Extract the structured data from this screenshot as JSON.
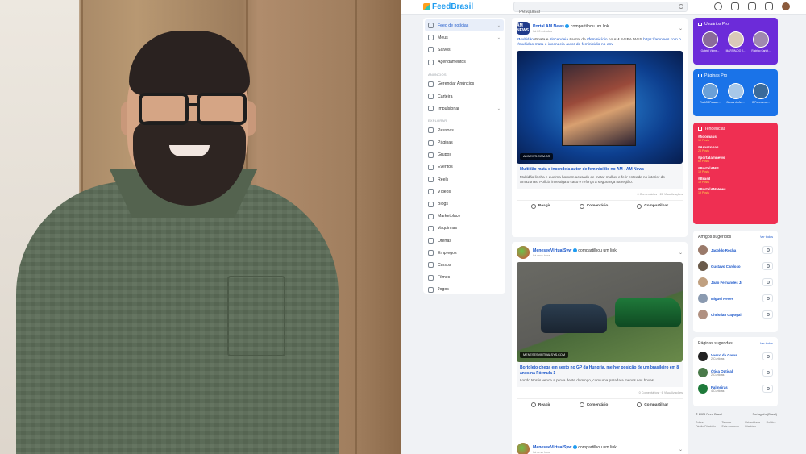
{
  "app": {
    "brand": "FeedBrasil",
    "search_placeholder": "Pesquisar"
  },
  "nav": {
    "main": [
      {
        "label": "Feed de notícias",
        "active": true,
        "has_chevron": true
      },
      {
        "label": "Meus",
        "has_chevron": true
      },
      {
        "label": "Salvos"
      },
      {
        "label": "Agendamentos"
      }
    ],
    "ads_section": "ANÚNCIOS",
    "ads": [
      {
        "label": "Gerenciar Anúncios"
      },
      {
        "label": "Carteira"
      },
      {
        "label": "Impulsionar",
        "has_chevron": true
      }
    ],
    "explore_section": "EXPLORAR",
    "explore": [
      {
        "label": "Pessoas"
      },
      {
        "label": "Páginas"
      },
      {
        "label": "Grupos"
      },
      {
        "label": "Eventos"
      },
      {
        "label": "Reels"
      },
      {
        "label": "Vídeos"
      },
      {
        "label": "Blogs"
      },
      {
        "label": "Marketplace"
      },
      {
        "label": "Vaquinhas"
      },
      {
        "label": "Ofertas"
      },
      {
        "label": "Empregos"
      },
      {
        "label": "Cursos"
      },
      {
        "label": "Filmes"
      },
      {
        "label": "Jogos"
      }
    ]
  },
  "posts": [
    {
      "avatar_text": "AM NEWS",
      "author": "Portal AM News",
      "action": "compartilhou um link",
      "time": "há 20 minutos",
      "text_parts": [
        {
          "t": "#Multidão",
          "tag": true
        },
        {
          "t": " #mata e "
        },
        {
          "t": "#incendeia",
          "tag": true
        },
        {
          "t": " #autor de "
        },
        {
          "t": "#feminicídio",
          "tag": true
        },
        {
          "t": " no AM SAIBA MAIS "
        },
        {
          "t": "https://amnews.com.br/multidao-mata-e-incendeia-autor-de-feminicidio-no-am/",
          "tag": true
        }
      ],
      "image_tag": "AMNEWS.COM.BR",
      "link_title": "Multidão mata e incendeia autor de feminicídio no AM - AM News",
      "link_desc": "Multidão lincha e queima homem acusado de matar mulher e ferir enteada no interior do Amazonas. Polícia investiga o caso e reforça a segurança na região.",
      "stats": "0 Comentários · 28 Visualizações",
      "actions": [
        "Reagir",
        "Comentário",
        "Compartilhar"
      ]
    },
    {
      "author": "MeneseeVirtualSyw",
      "action": "compartilhou um link",
      "time": "há uma hora",
      "image_tag": "MENESESVIRTUALSYS.COM",
      "link_title": "Bortoleto chega em sexto no GP da Hungria, melhor posição de um brasileiro em 8 anos na Fórmula 1",
      "link_desc": "Londo Norris vence a prova deste domingo, com uma parada a menos nos boxes",
      "stats": "0 Comentários · 6 Visualizações",
      "actions": [
        "Reagir",
        "Comentário",
        "Compartilhar"
      ]
    },
    {
      "author": "MeneseeVirtualSyw",
      "action": "compartilhou um link",
      "time": "há uma hora"
    }
  ],
  "sidebar": {
    "pro_users": {
      "title": "Usuários Pro",
      "users": [
        "Gabriel Vidme...",
        "MARIVALDO J...",
        "Rodrigo Carlot..."
      ]
    },
    "pro_pages": {
      "title": "Páginas Pro",
      "pages": [
        "RockSGPassan...",
        "Canais da Am...",
        "O Povo Amaz..."
      ]
    },
    "trends": {
      "title": "Tendências",
      "items": [
        {
          "tag": "#fidomaus",
          "count": "19 Posts"
        },
        {
          "tag": "#Amazonas",
          "count": "24 Posts"
        },
        {
          "tag": "#portalamnews",
          "count": "60 Posts"
        },
        {
          "tag": "#PortalAMS",
          "count": "19 Posts"
        },
        {
          "tag": "#Brasil",
          "count": "19 Posts"
        },
        {
          "tag": "#PortalAMNews",
          "count": "19 Posts"
        }
      ]
    },
    "friends": {
      "title": "Amigos sugeridos",
      "see_all": "Ver todos",
      "items": [
        "Jacoldo Rocha",
        "Gustavo Cardoso",
        "Joao Fernandes Jr",
        "Miguel Neves",
        "Christian Capogal"
      ]
    },
    "pages": {
      "title": "Páginas sugeridas",
      "see_all": "Ver todos",
      "items": [
        {
          "name": "Vasco da Gama",
          "sub": "2 Curtidas"
        },
        {
          "name": "Ótica Optical",
          "sub": "2 Curtidas"
        },
        {
          "name": "Palmeiras",
          "sub": "4 Curtidas"
        }
      ]
    },
    "footer": {
      "copyright": "© 2025 Feed Brasil",
      "language": "Português (Brasil)",
      "links": [
        "Sobre",
        "Termos",
        "Privacidade",
        "Política",
        "Direito Diretório",
        "Fale conosco",
        "Diretório"
      ]
    }
  },
  "colors": {
    "accent": "#1a56c9",
    "pro_users_bg": "#6c2bd9",
    "pro_pages_bg": "#1a73e8",
    "trends_bg": "#ef2f52"
  }
}
